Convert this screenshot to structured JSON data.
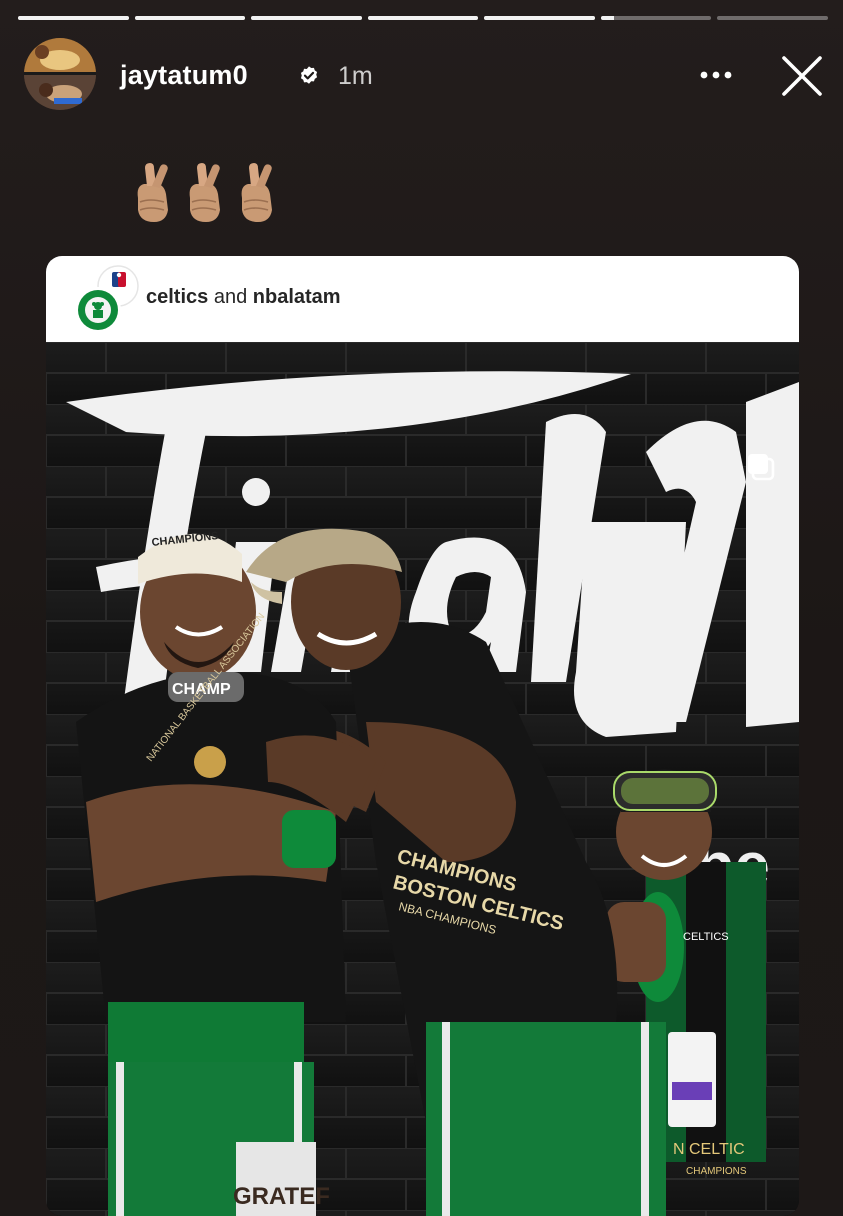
{
  "story": {
    "segments": [
      1,
      1,
      1,
      1,
      1,
      0.12,
      0
    ],
    "author": {
      "username": "jaytatum0",
      "verified": true,
      "time": "1m"
    },
    "icons": {
      "verified": "verified-badge-icon",
      "more": "more-horizontal-icon",
      "close": "close-icon",
      "sticker": "crossed-fingers-emoji"
    },
    "sticker_count": 3
  },
  "shared_post": {
    "authors": [
      "celtics",
      "nbalatam"
    ],
    "joiner": "and",
    "carousel_icon": "carousel-multiple-icon",
    "photo_text": {
      "wall_script": "Final",
      "wall_partial": "ube",
      "cap_text": "CHAMPIONS",
      "shirt_badge": "CHAMP",
      "shirt_lines": [
        "NATIONAL BASKETBALL ASSOCIATION",
        "CHAMPIONS",
        "BOSTON CELTICS",
        "NBA CHAMPIONS"
      ],
      "kid_badge": "CELTICS",
      "kid_lanyard": "N CELTIC",
      "kid_lanyard_sub": "CHAMPIONS",
      "knee_text": "GRATEF"
    }
  },
  "colors": {
    "background": "#1e1918",
    "card_header": "#ffffff",
    "celtics_green": "#0e8a3a",
    "skin_emoji": "#d7a783"
  }
}
